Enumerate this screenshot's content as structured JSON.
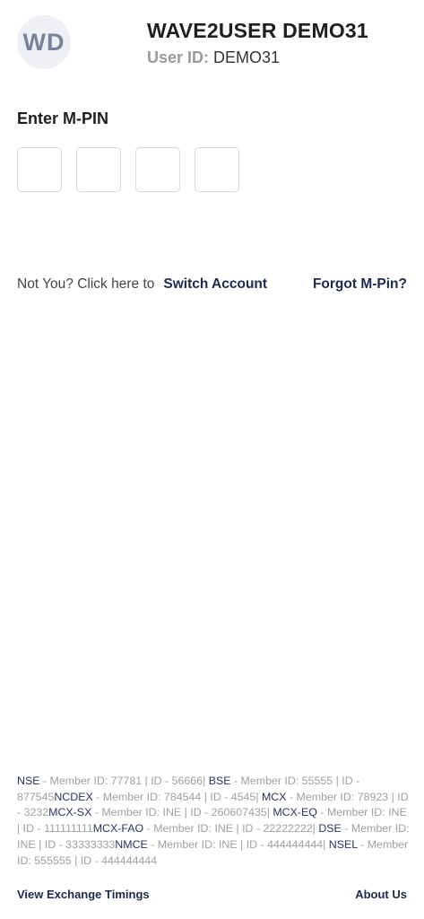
{
  "user": {
    "initials": "WD",
    "name": "WAVE2USER DEMO31",
    "id_label": "User ID:",
    "id_value": "DEMO31"
  },
  "mpin": {
    "title": "Enter M-PIN",
    "boxes": [
      "",
      "",
      "",
      ""
    ]
  },
  "account": {
    "not_you_text": "Not You? Click here to",
    "switch_label": "Switch Account",
    "forgot_label": "Forgot M-Pin?"
  },
  "exchanges": [
    {
      "name": "NSE",
      "details": " - Member ID: 77781 | ID - 56666| "
    },
    {
      "name": "BSE",
      "details": " - Member ID: 55555 | ID - 877545"
    },
    {
      "name": "NCDEX",
      "details": " - Member ID: 784544 | ID - 4545| "
    },
    {
      "name": "MCX",
      "details": " - Member ID: 78923 | ID - 3232"
    },
    {
      "name": "MCX-SX",
      "details": " - Member ID: INE | ID - 260607435| "
    },
    {
      "name": "MCX-EQ",
      "details": " - Member ID: INE | ID - 111111111"
    },
    {
      "name": "MCX-FAO",
      "details": " - Member ID: INE | ID - 22222222| "
    },
    {
      "name": "DSE",
      "details": " - Member ID: INE | ID - 33333333"
    },
    {
      "name": "NMCE",
      "details": " - Member ID: INE | ID - 444444444| "
    },
    {
      "name": "NSEL",
      "details": " - Member ID: 555555 | ID - 444444444"
    }
  ],
  "footer": {
    "timings_label": "View Exchange Timings",
    "about_label": "About Us"
  }
}
